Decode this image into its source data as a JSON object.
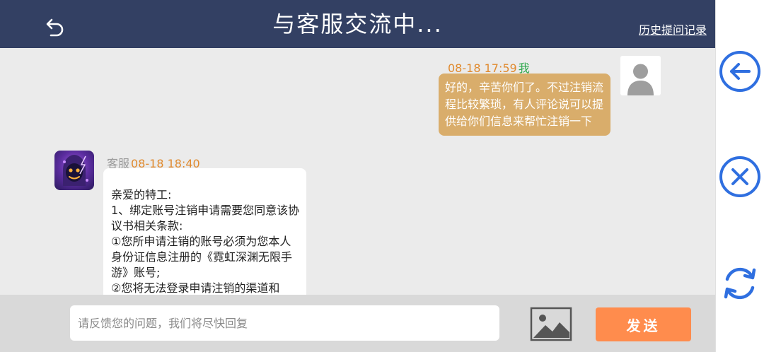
{
  "header": {
    "title": "与客服交流中...",
    "history_link": "历史提问记录",
    "back_icon": "back-arrow-icon"
  },
  "messages": [
    {
      "sender": "me",
      "time": "08-18 17:59",
      "who": "我",
      "text": "好的，辛苦你们了。不过注销流程比较繁琐，有人评论说可以提供给你们信息来帮忙注销一下"
    },
    {
      "sender": "cs",
      "who": "客服",
      "time": "08-18 18:40",
      "lines": [
        "亲爱的特工:",
        "1、绑定账号注销申请需要您同意该协议书相关条款:",
        "①您所申请注销的账号必须为您本人身份证信息注册的《霓虹深渊无限手游》账号;",
        "②您将无法登录申请注销的渠道和"
      ]
    }
  ],
  "input": {
    "placeholder": "请反馈您的问题，我们将尽快回复",
    "value": ""
  },
  "send_label": "发送",
  "side_icons": [
    "circle-back-arrow-icon",
    "circle-close-icon",
    "refresh-icon"
  ],
  "colors": {
    "header_bg": "#334063",
    "my_bubble": "#d9ad6b",
    "time": "#e08a2e",
    "me_label": "#2ea84d",
    "send_button": "#ff8c4d",
    "side_icon": "#2f6fe0"
  }
}
